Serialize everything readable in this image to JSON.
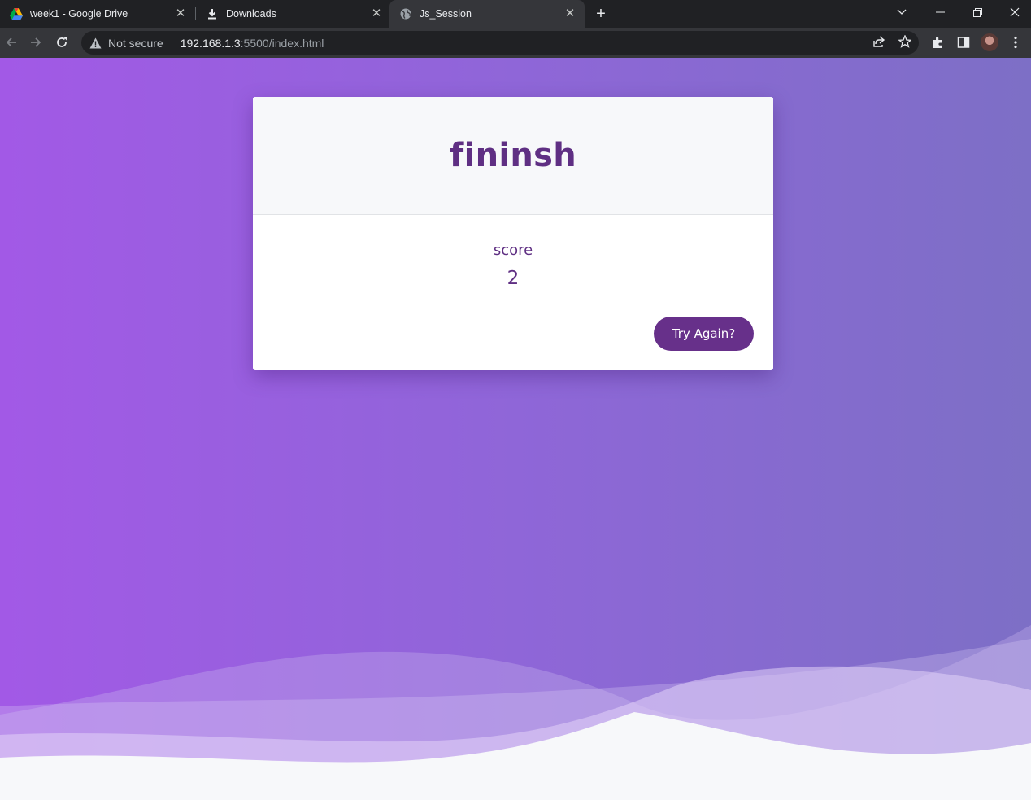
{
  "browser": {
    "tabs": [
      {
        "title": "week1 - Google Drive",
        "icon": "google-drive-icon"
      },
      {
        "title": "Downloads",
        "icon": "download-icon"
      },
      {
        "title": "Js_Session",
        "icon": "globe-icon",
        "active": true
      }
    ],
    "address": {
      "security_label": "Not secure",
      "host": "192.168.1.3",
      "path": ":5500/index.html"
    }
  },
  "quiz": {
    "title": "fininsh",
    "score_label": "score",
    "score_value": "2",
    "retry_label": "Try Again?"
  },
  "colors": {
    "accent": "#67308a",
    "text": "#5f2f83",
    "background_start": "#a259e6",
    "background_end": "#7d6fc6"
  }
}
